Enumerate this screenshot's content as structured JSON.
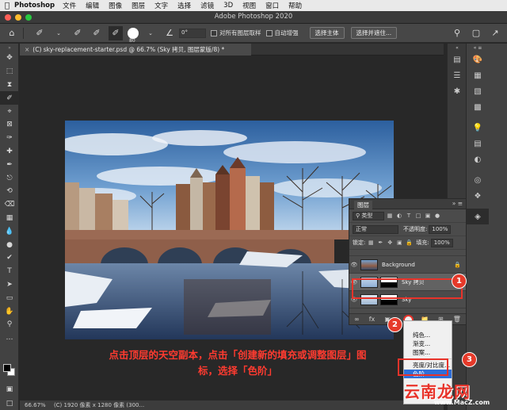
{
  "menubar": {
    "app": "Photoshop",
    "items": [
      "文件",
      "编辑",
      "图像",
      "图层",
      "文字",
      "选择",
      "滤镜",
      "3D",
      "视图",
      "窗口",
      "帮助"
    ]
  },
  "window": {
    "title": "Adobe Photoshop 2020"
  },
  "options": {
    "brush_size": "80",
    "angle": "0°",
    "sample_all_layers": "对所有图层取样",
    "auto_enhance": "自动增强",
    "select_subject": "选择主体",
    "select_mask": "选择并遮住..."
  },
  "document": {
    "tab_title": "(C) sky-replacement-starter.psd @ 66.7% (Sky  拷贝, 图层蒙版/8) *"
  },
  "status": {
    "zoom": "66.67%",
    "info": "(C) 1920 像素 x 1280 像素 (300..."
  },
  "layers_panel": {
    "title": "图层",
    "filter_kind": "类型",
    "blend_mode": "正常",
    "opacity_label": "不透明度:",
    "opacity_value": "100%",
    "lock_label": "锁定:",
    "fill_label": "填充:",
    "fill_value": "100%",
    "layers": [
      {
        "name": "Background",
        "selected": false
      },
      {
        "name": "Sky  拷贝",
        "selected": true
      },
      {
        "name": "Sky",
        "selected": false
      }
    ]
  },
  "context_menu": {
    "items": [
      "纯色...",
      "渐变...",
      "图案...",
      "亮度/对比度...",
      "色阶..."
    ],
    "selected": "色阶..."
  },
  "annotations": {
    "badge1": "1",
    "badge2": "2",
    "badge3": "3",
    "instruction_line1": "点击顶层的天空副本，点击「创建新的填充或调整图层」图",
    "instruction_line2": "标，选择「色阶」"
  },
  "watermark": {
    "brand": "云南龙网",
    "url": "www.MacZ.com"
  },
  "colors": {
    "accent_red": "#e8332a",
    "menu_selected": "#2d6fd9"
  }
}
